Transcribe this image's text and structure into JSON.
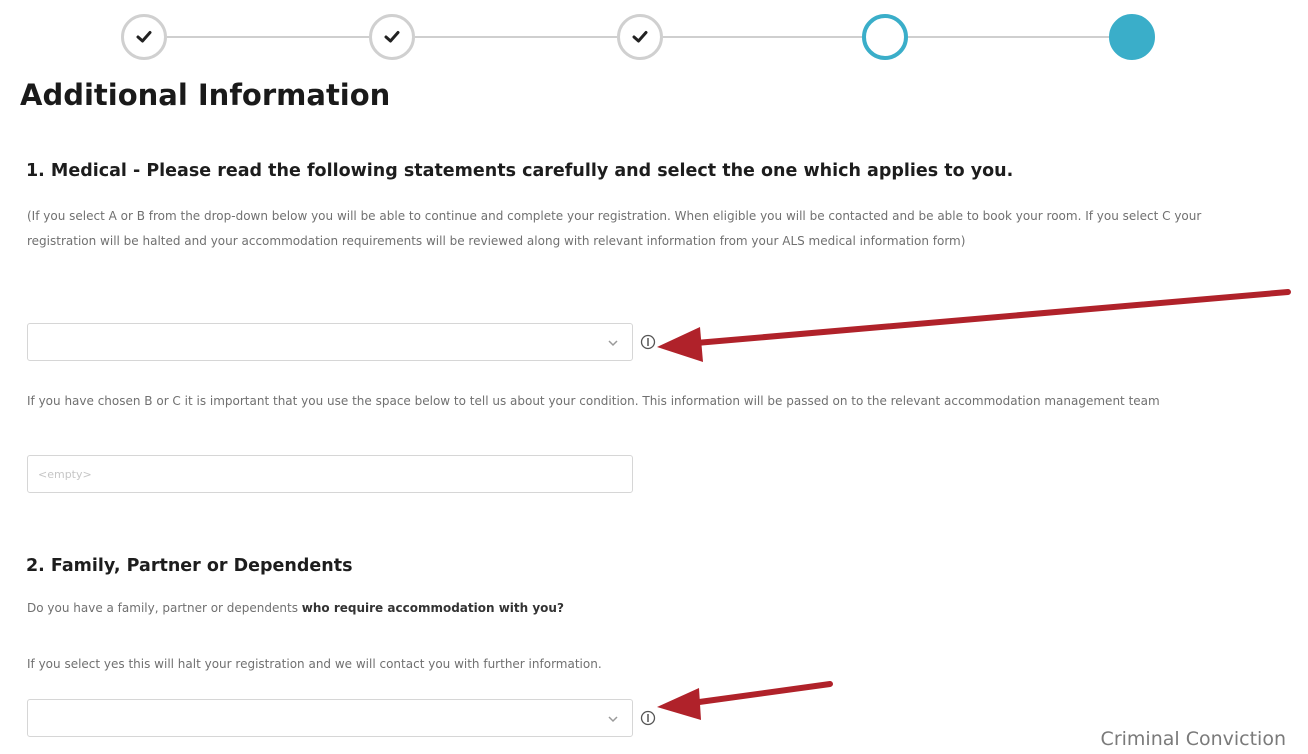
{
  "stepper": {
    "steps": [
      {
        "state": "complete",
        "icon": "check-icon"
      },
      {
        "state": "complete",
        "icon": "check-icon"
      },
      {
        "state": "complete",
        "icon": "check-icon"
      },
      {
        "state": "current"
      },
      {
        "state": "upcoming"
      }
    ],
    "colors": {
      "accent": "#3aaec9",
      "complete_border": "#d0d0d0",
      "line": "#cfcfcf"
    }
  },
  "page": {
    "title": "Additional Information"
  },
  "medical": {
    "heading": "1. Medical - Please read the following statements carefully and select the one which applies to you.",
    "intro": "(If you select A or B from the drop-down below you will be able to continue and complete your registration. When eligible you will be contacted and be able to book your room. If you select C your registration will be halted and your accommodation requirements will be reviewed along with relevant information from your ALS medical information form)",
    "select": {
      "value": "",
      "icon": "chevron-down-icon",
      "info_icon": "info-icon"
    },
    "condition_prompt": "If you have chosen B or C it is important that you use the space below to tell us about your condition. This information will be passed on to the relevant accommodation management team",
    "condition_input": {
      "value": "",
      "placeholder": "<empty>"
    }
  },
  "family": {
    "heading": "2. Family, Partner or Dependents",
    "question_prefix": "Do you have a family, partner or dependents ",
    "question_bold": "who require accommodation with you?",
    "note": "If you select yes this will halt your registration and we will contact you with further information.",
    "select": {
      "value": "",
      "icon": "chevron-down-icon",
      "info_icon": "info-icon"
    }
  },
  "sidebar": {
    "next_section": "Criminal Conviction"
  },
  "annotations": {
    "arrow_color": "#b0222a"
  }
}
